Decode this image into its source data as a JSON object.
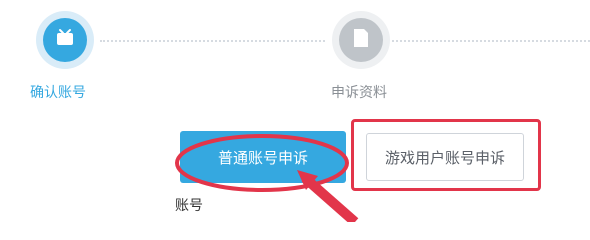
{
  "steps": [
    {
      "label": "确认账号",
      "icon": "tv-icon",
      "state": "active",
      "color": "#35a8e0"
    },
    {
      "label": "申诉资料",
      "icon": "document-icon",
      "state": "inactive",
      "color": "#bfc4c9"
    }
  ],
  "buttons": {
    "normal_appeal": "普通账号申诉",
    "game_appeal": "游戏用户账号申诉"
  },
  "form": {
    "account_label": "账号"
  },
  "colors": {
    "accent": "#35a8e0",
    "highlight": "#e2354a"
  }
}
